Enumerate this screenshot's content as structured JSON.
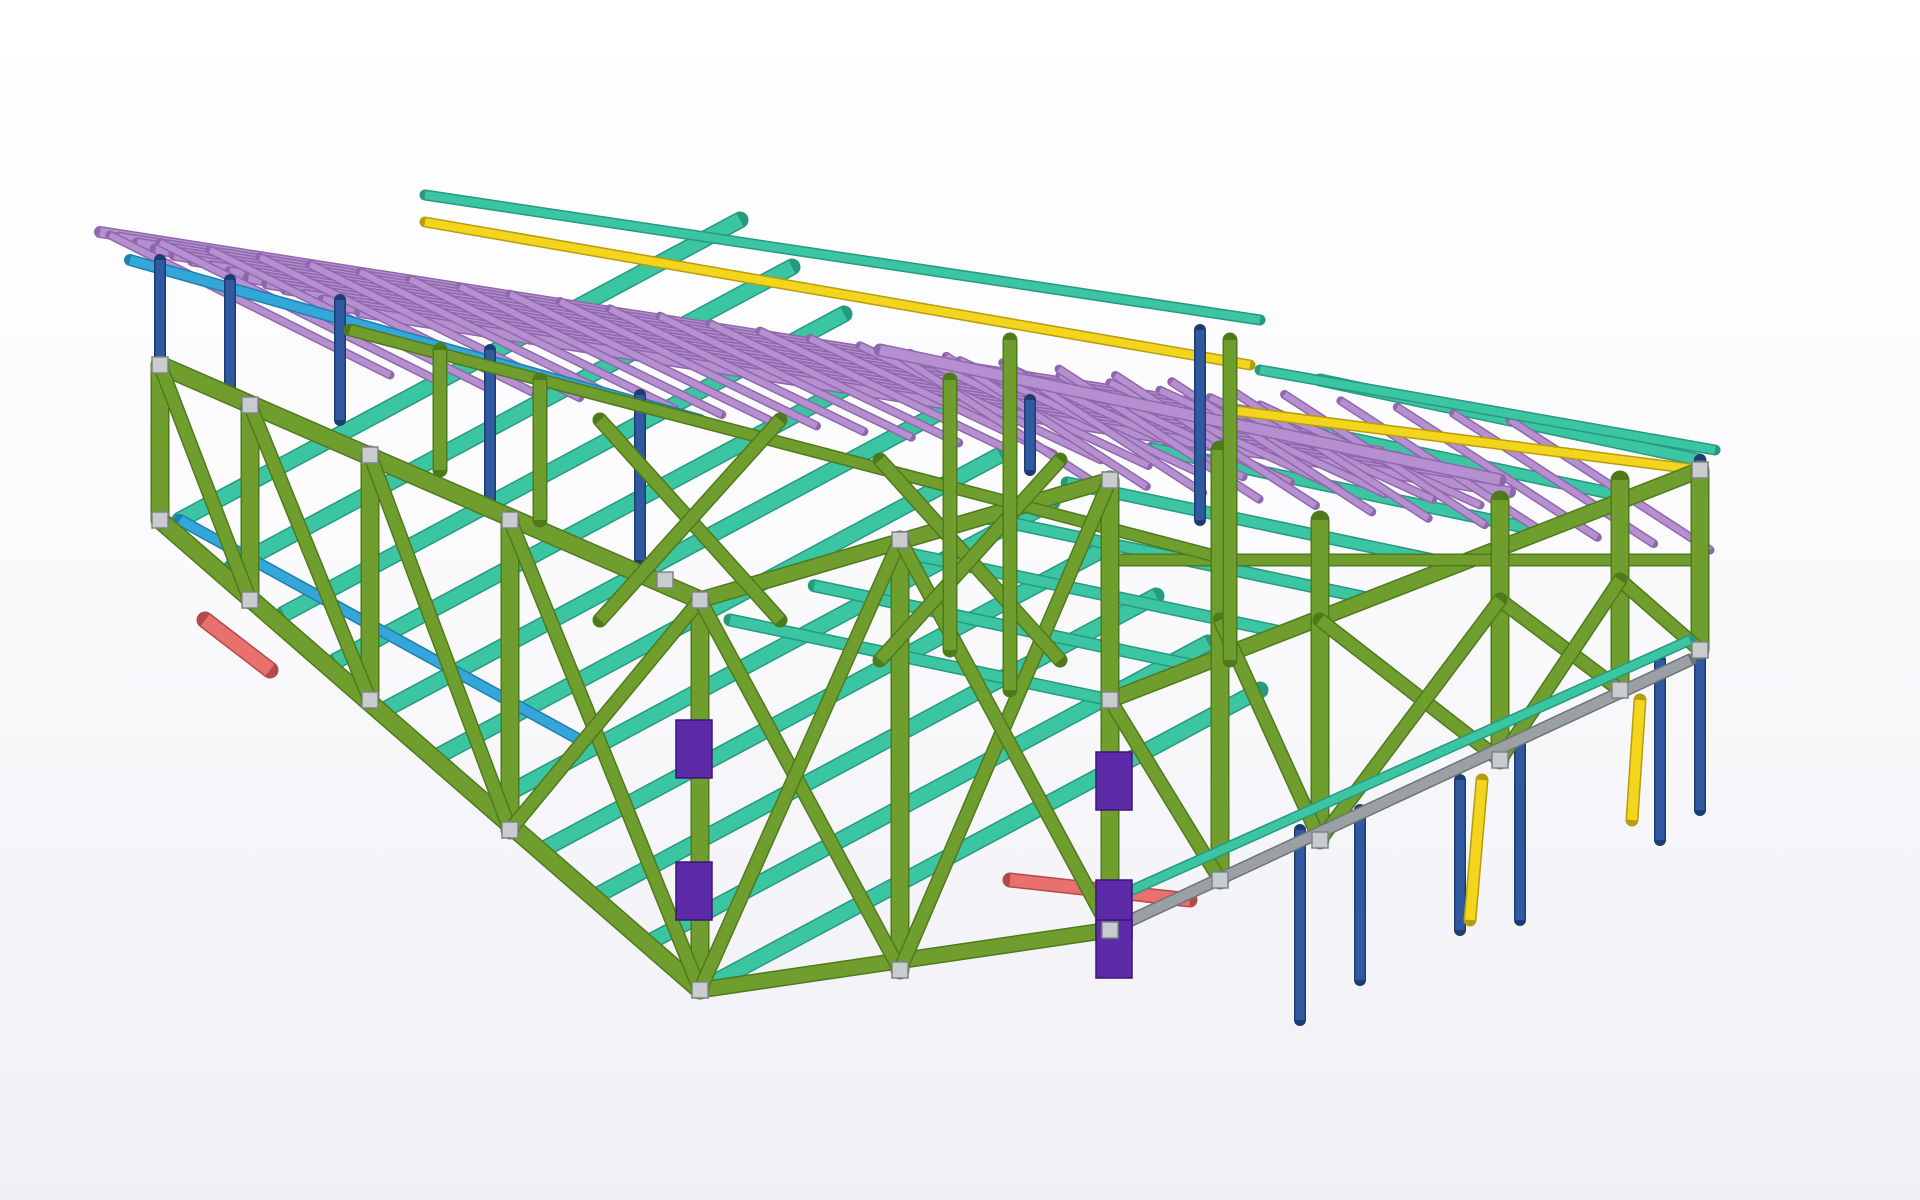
{
  "viewport": {
    "kind": "3d-model-view",
    "model": "steel-frame-structure",
    "background_top": "#ffffff",
    "background_bottom": "#efeff5"
  },
  "member_colors": {
    "frame_green": "#6f9e2e",
    "frame_green_dark": "#4f7a1c",
    "beam_teal": "#3cc5a3",
    "beam_teal_dark": "#259a7e",
    "purlin_violet": "#b68fd0",
    "purlin_violet_dark": "#8e67ad",
    "column_blue": "#2f5aa0",
    "brace_cyan": "#34a6da",
    "rail_yellow": "#f2d51c",
    "edge_red": "#e8706f",
    "plate_purple": "#5d2aa8",
    "rail_grey": "#9aa0a4"
  }
}
